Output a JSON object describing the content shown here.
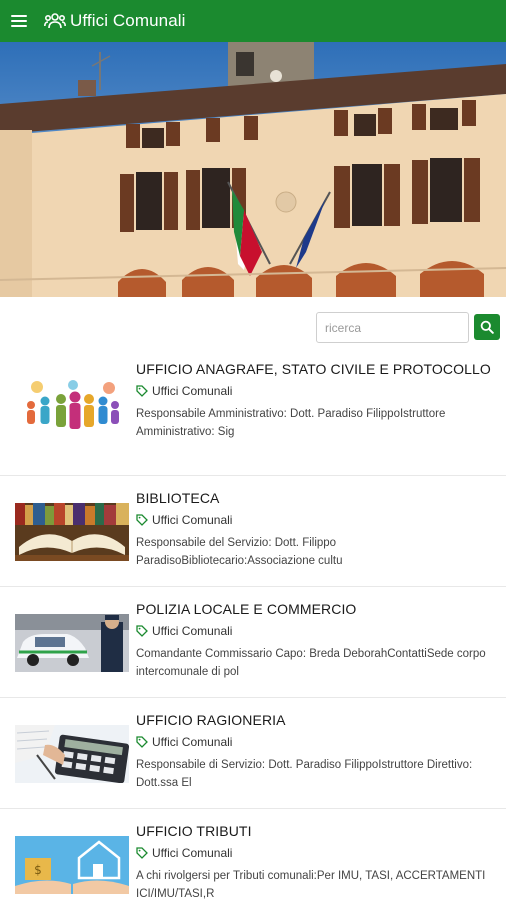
{
  "app": {
    "title": "Uffici Comunali",
    "accent_color": "#1b8a2f",
    "menu_icon": "hamburger-icon",
    "title_icon": "group-icon"
  },
  "search": {
    "placeholder": "ricerca",
    "button_icon": "search-icon"
  },
  "items": [
    {
      "title": "UFFICIO ANAGRAFE, STATO CIVILE E PROTOCOLLO",
      "tag": "Uffici Comunali",
      "excerpt": "Responsabile Amministrativo: Dott. Paradiso FilippoIstruttore Amministrativo: Sig"
    },
    {
      "title": "BIBLIOTECA",
      "tag": "Uffici Comunali",
      "excerpt": "Responsabile del Servizio: Dott. Filippo ParadisoBibliotecario:Associazione cultu"
    },
    {
      "title": "POLIZIA LOCALE E COMMERCIO",
      "tag": "Uffici Comunali",
      "excerpt": "Comandante Commissario Capo: Breda DeborahContattiSede corpo intercomunale di pol"
    },
    {
      "title": "UFFICIO RAGIONERIA",
      "tag": "Uffici Comunali",
      "excerpt": "Responsabile di Servizio: Dott. Paradiso FilippoIstruttore Direttivo: Dott.ssa El"
    },
    {
      "title": "UFFICIO TRIBUTI",
      "tag": "Uffici Comunali",
      "excerpt": "A chi rivolgersi per Tributi comunali:Per IMU, TASI, ACCERTAMENTI ICI/IMU/TASI,R"
    }
  ]
}
